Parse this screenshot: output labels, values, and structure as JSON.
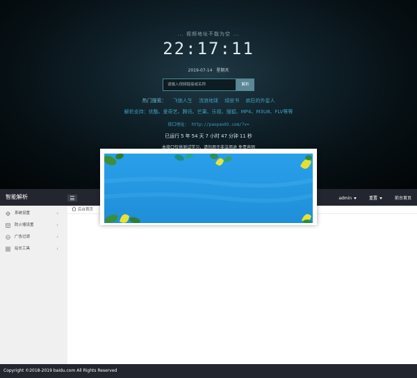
{
  "player": {
    "notice": "... 视频地址不能为空 ...",
    "clock": "22:17:11",
    "date": "2019-07-14",
    "weekday": "星期天",
    "search_placeholder": "请输入视频链接或名称",
    "search_button": "解析",
    "hot_label": "热门搜索：",
    "hot_keywords": [
      "飞驰人生",
      "流浪地球",
      "绿皮书",
      "疯狂的外星人"
    ],
    "support_text": "解析支持：优酷、爱奇艺、腾讯、芒果、乐视、搜狐、MP4、M3U8、FLV等等",
    "api_label": "接口地址：",
    "api_url": "http://paopao02.com/?v=",
    "uptime": {
      "prefix": "已运行",
      "years": "5",
      "years_unit": "年",
      "days": "54",
      "days_unit": "天",
      "hours": "7",
      "hours_unit": "小时",
      "minutes": "47",
      "minutes_unit": "分钟",
      "seconds": "11",
      "seconds_unit": "秒"
    },
    "disclaimer": "本接口仅供测试学习，请勿用于非法用途 免责声明"
  },
  "admin": {
    "brand": "智能解析",
    "header_items": [
      "admin",
      "重置",
      "前台首页"
    ],
    "sidebar": [
      {
        "label": "系统设置",
        "icon": "gear-icon"
      },
      {
        "label": "防火墙设置",
        "icon": "shield-icon"
      },
      {
        "label": "广告过滤",
        "icon": "filter-icon"
      },
      {
        "label": "站长工具",
        "icon": "grid-icon"
      }
    ],
    "home_tab": "后台首页",
    "footer": "Copyright ©2018-2019 baidu.com All Rights Reserved"
  },
  "colors": {
    "header_bg": "#23262e",
    "link_blue": "#3f9fbc",
    "popup_sky": "#2d9fe6"
  }
}
